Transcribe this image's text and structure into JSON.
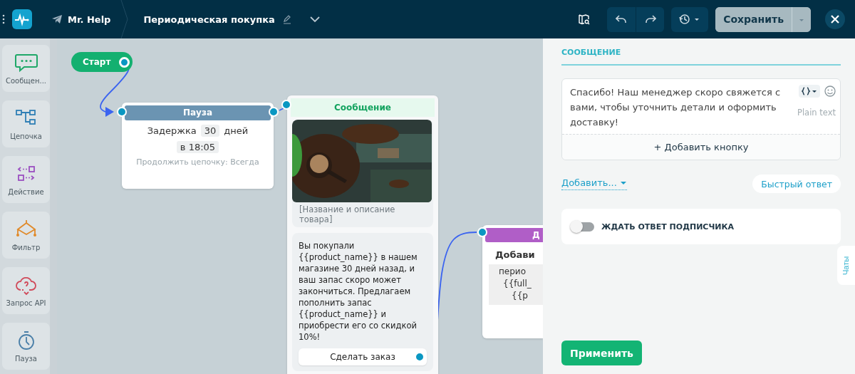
{
  "topbar": {
    "bot_name": "Mr. Help",
    "flow_title": "Периодическая покупка",
    "save_label": "Сохранить"
  },
  "sidebar": {
    "items": [
      {
        "kind": "message",
        "label": "Сообщен..."
      },
      {
        "kind": "chain",
        "label": "Цепочка"
      },
      {
        "kind": "action",
        "label": "Действие"
      },
      {
        "kind": "filter",
        "label": "Фильтр"
      },
      {
        "kind": "api",
        "label": "Запрос API"
      },
      {
        "kind": "pause",
        "label": "Пауза"
      }
    ]
  },
  "canvas": {
    "start": {
      "label": "Старт"
    },
    "pause_node": {
      "title": "Пауза",
      "delay_label": "Задержка",
      "delay_value": "30",
      "delay_unit": "дней",
      "time": "в 18:05",
      "continue": "Продолжить цепочку: Всегда"
    },
    "message_node": {
      "title": "Сообщение",
      "caption": "[Название и описание товара]",
      "text": "Вы покупали {{product_name}} в нашем магазине 30 дней назад, и ваш запас скоро может закончиться. Предлагаем пополнить запас {{product_name}} и приобрести его со скидкой 10%!",
      "button": "Сделать заказ"
    },
    "action_node": {
      "title": "Д",
      "heading": "Добави",
      "lines": [
        "перио",
        "{{full_",
        "{{p"
      ]
    }
  },
  "panel": {
    "section_title": "СООБЩЕНИЕ",
    "message_text": "Спасибо! Наш менеджер скоро свяжется с вами, чтобы уточнить детали и оформить доставку!",
    "format_label": "Plain text",
    "add_button": "+ Добавить кнопку",
    "add_menu": "Добавить...",
    "quick_reply": "Быстрый ответ",
    "wait_toggle": {
      "label": "ЖДАТЬ ОТВЕТ ПОДПИСЧИКА",
      "on": false
    },
    "apply": "Применить",
    "chats_tab": "Чаты"
  }
}
